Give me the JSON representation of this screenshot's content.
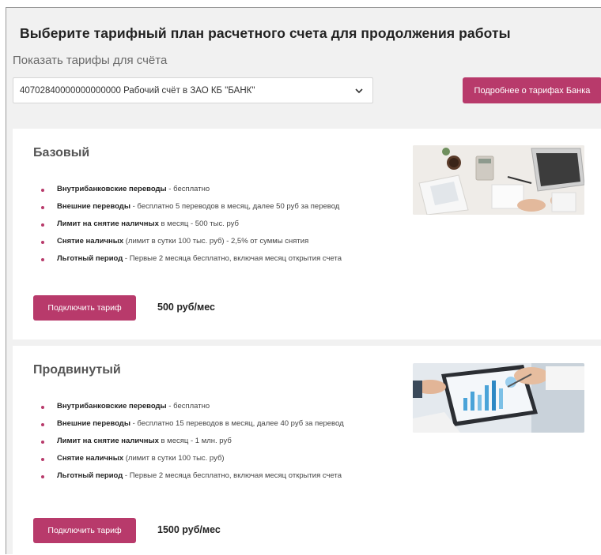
{
  "page": {
    "title": "Выберите тарифный план расчетного счета для продолжения работы",
    "account_label": "Показать тарифы для счёта",
    "account_selected": "40702840000000000000 Рабочий счёт в ЗАО КБ \"БАНК\"",
    "tariffs_info_button": "Подробнее о тарифах Банка"
  },
  "plans": [
    {
      "name": "Базовый",
      "features": [
        {
          "title": "Внутрибанковские переводы",
          "text": " - бесплатно"
        },
        {
          "title": "Внешние переводы",
          "text": " - бесплатно 5 переводов в месяц, далее 50 руб за перевод"
        },
        {
          "title": "Лимит на снятие наличных",
          "text": " в месяц - 500 тыс. руб"
        },
        {
          "title": "Снятие наличных",
          "text": " (лимит в сутки 100 тыс. руб) - 2,5% от суммы снятия"
        },
        {
          "title": "Льготный период",
          "text": " - Первые 2 месяца бесплатно, включая месяц открытия счета"
        }
      ],
      "connect_label": "Подключить тариф",
      "price": "500 руб/мес",
      "image": "office-desk-photo"
    },
    {
      "name": "Продвинутый",
      "features": [
        {
          "title": "Внутрибанковские переводы",
          "text": " - бесплатно"
        },
        {
          "title": "Внешние переводы",
          "text": " - бесплатно 15 переводов в месяц, далее 40 руб за перевод"
        },
        {
          "title": "Лимит на снятие наличных",
          "text": " в месяц - 1 млн. руб"
        },
        {
          "title": "Снятие наличных",
          "text": " (лимит в сутки 100 тыс. руб)"
        },
        {
          "title": "Льготный период",
          "text": " - Первые 2 месяца бесплатно, включая месяц открытия счета"
        }
      ],
      "connect_label": "Подключить тариф",
      "price": "1500 руб/мес",
      "image": "business-charts-photo"
    }
  ],
  "colors": {
    "accent": "#b83a6b",
    "background": "#f1f1f1",
    "card": "#ffffff"
  }
}
